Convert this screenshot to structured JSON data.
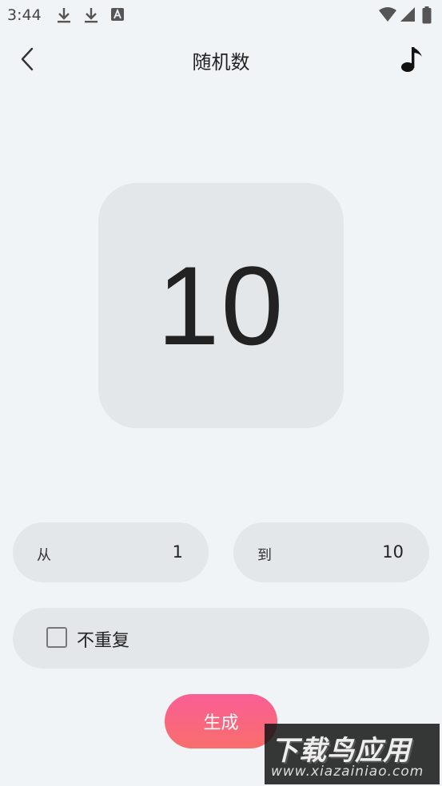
{
  "status_bar": {
    "time": "3:44",
    "icons": [
      "download-icon",
      "download-icon",
      "accessibility-icon",
      "wifi-icon",
      "signal-icon",
      "battery-icon"
    ]
  },
  "header": {
    "title": "随机数",
    "back_icon": "chevron-left-icon",
    "music_icon": "music-note-icon"
  },
  "result": {
    "value": "10"
  },
  "range": {
    "from_label": "从",
    "from_value": "1",
    "to_label": "到",
    "to_value": "10"
  },
  "options": {
    "no_repeat_label": "不重复",
    "no_repeat_checked": false
  },
  "actions": {
    "generate_label": "生成"
  },
  "watermark": {
    "title": "下载鸟应用",
    "url": "www.xiazainiao.com"
  },
  "colors": {
    "background": "#f1f4f6",
    "card": "#e4e7e9",
    "button_gradient_start": "#fa5e96",
    "button_gradient_end": "#f86e6b"
  }
}
